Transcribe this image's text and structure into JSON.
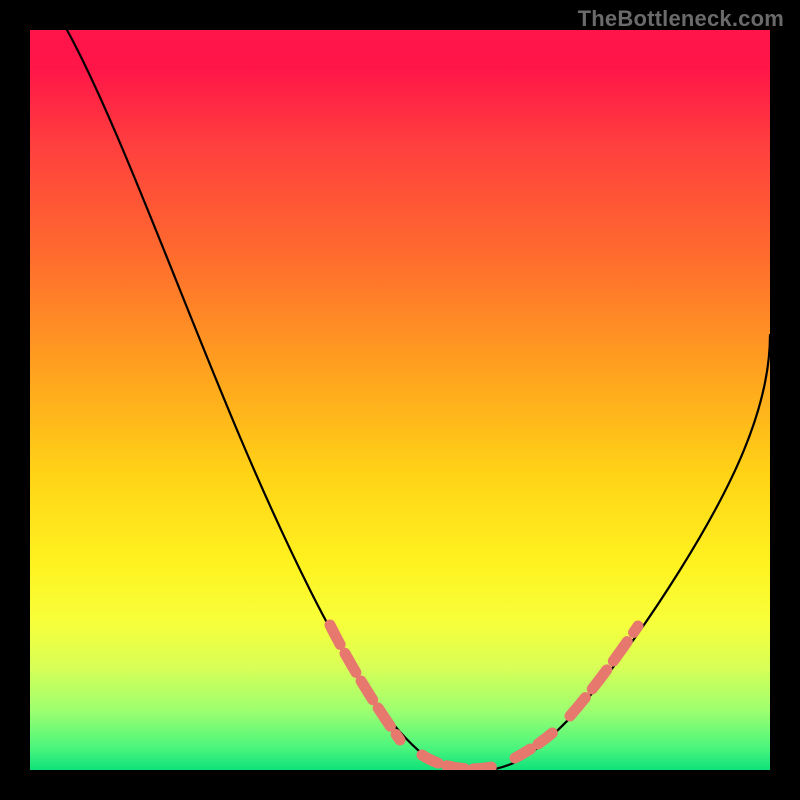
{
  "watermark": "TheBottleneck.com",
  "chart_data": {
    "type": "line",
    "title": "",
    "xlabel": "",
    "ylabel": "",
    "xlim": [
      0,
      100
    ],
    "ylim": [
      0,
      100
    ],
    "series": [
      {
        "name": "bottleneck-curve",
        "x": [
          5,
          10,
          15,
          20,
          25,
          30,
          35,
          40,
          45,
          50,
          53,
          56,
          60,
          62,
          65,
          70,
          75,
          80,
          85,
          90,
          95,
          100
        ],
        "values": [
          100,
          95,
          89,
          82,
          74,
          65,
          55,
          44,
          33,
          21,
          12,
          6,
          1,
          0,
          1,
          6,
          13,
          21,
          30,
          39,
          49,
          59
        ]
      }
    ],
    "annotations": {
      "highlight_segments": [
        {
          "x_start": 40,
          "x_end": 50,
          "side": "left"
        },
        {
          "x_start": 53,
          "x_end": 69,
          "side": "valley"
        },
        {
          "x_start": 70,
          "x_end": 78,
          "side": "right"
        }
      ],
      "highlight_color": "#e6786e"
    },
    "background_gradient": {
      "top": "#ff154a",
      "bottom": "#0fe27a"
    }
  }
}
